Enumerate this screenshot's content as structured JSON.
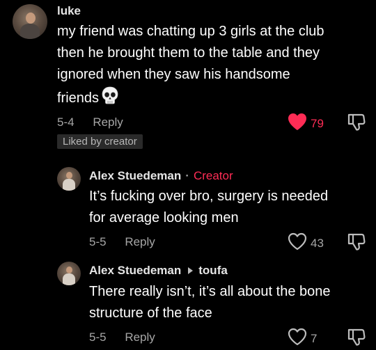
{
  "colors": {
    "background": "#000000",
    "creator_tag": "#fe2c55",
    "liked_heart": "#fe2c55",
    "muted_text": "#a6a6a6"
  },
  "comments": [
    {
      "username": "luke",
      "text_lines": [
        "my friend was chatting up 3 girls at the club",
        "then he brought them to the table and they",
        "ignored when they saw his handsome",
        "friends"
      ],
      "emoji": "skull-icon",
      "date": "5-4",
      "reply_label": "Reply",
      "likes": "79",
      "liked": true,
      "liked_by": "Liked by creator"
    },
    {
      "username": "Alex Stuedeman",
      "separator": "·",
      "creator_label": "Creator",
      "text_lines": [
        "It’s fucking over bro, surgery is needed",
        "for average looking men"
      ],
      "date": "5-5",
      "reply_label": "Reply",
      "likes": "43",
      "liked": false
    },
    {
      "username": "Alex Stuedeman",
      "reply_to": "toufa",
      "text_lines": [
        "There really isn’t, it’s all about the bone",
        "structure of the face"
      ],
      "date": "5-5",
      "reply_label": "Reply",
      "likes": "7",
      "liked": false
    }
  ]
}
